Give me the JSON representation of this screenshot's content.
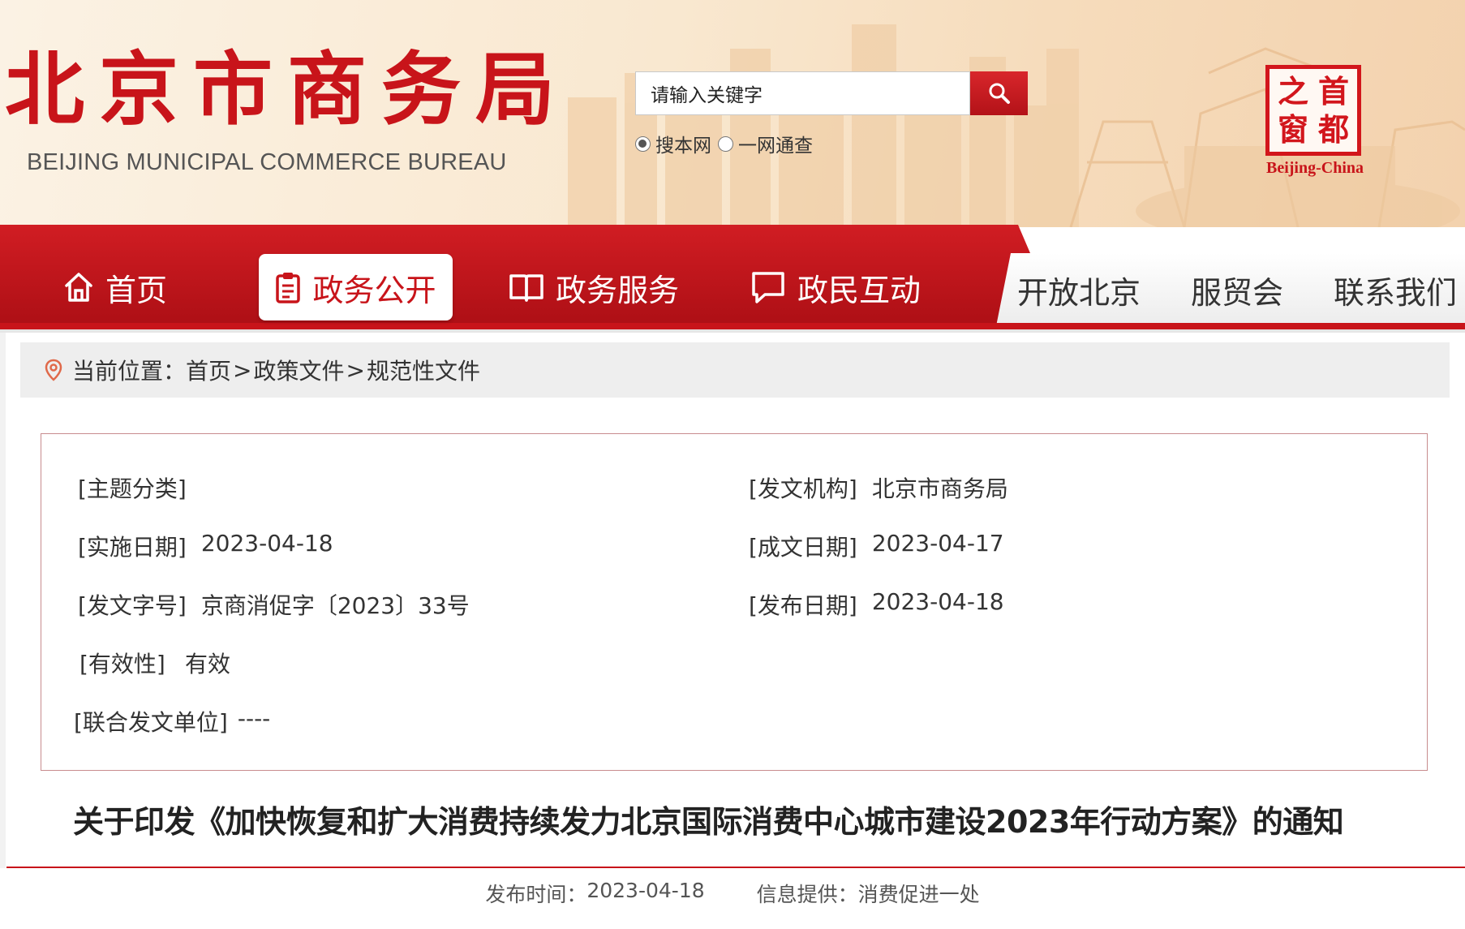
{
  "header": {
    "title": "北京市商务局",
    "subtitle": "BEIJING MUNICIPAL COMMERCE BUREAU",
    "search_placeholder": "请输入关键字",
    "search_options": [
      {
        "label": "搜本网",
        "selected": true
      },
      {
        "label": "一网通查",
        "selected": false
      }
    ],
    "seal_chars": [
      "之",
      "首",
      "窗",
      "都"
    ],
    "seal_caption": "Beijing-China"
  },
  "nav": {
    "items": [
      {
        "label": "首页",
        "icon": "home-icon",
        "active": false
      },
      {
        "label": "政务公开",
        "icon": "clipboard-icon",
        "active": true
      },
      {
        "label": "政务服务",
        "icon": "book-icon",
        "active": false
      },
      {
        "label": "政民互动",
        "icon": "chat-icon",
        "active": false
      },
      {
        "label": "开放北京",
        "active": false
      },
      {
        "label": "服贸会",
        "active": false
      },
      {
        "label": "联系我们",
        "active": false
      }
    ]
  },
  "breadcrumb": {
    "prefix": "当前位置：",
    "items": [
      "首页",
      "政策文件",
      "规范性文件"
    ],
    "separator": ">"
  },
  "doc_info": {
    "topic": {
      "label": "[主题分类]",
      "value": ""
    },
    "issuer": {
      "label": "[发文机构]",
      "value": "北京市商务局"
    },
    "effective_date": {
      "label": "[实施日期]",
      "value": "2023-04-18"
    },
    "written_date": {
      "label": "[成文日期]",
      "value": "2023-04-17"
    },
    "doc_number": {
      "label": "[发文字号]",
      "value": "京商消促字〔2023〕33号"
    },
    "publish_date": {
      "label": "[发布日期]",
      "value": "2023-04-18"
    },
    "validity": {
      "label": "[有效性]",
      "value": "有效"
    },
    "joint_issuers": {
      "label": "[联合发文单位]",
      "value": "----"
    }
  },
  "article": {
    "title": "关于印发《加快恢复和扩大消费持续发力北京国际消费中心城市建设2023年行动方案》的通知",
    "publish_time_label": "发布时间：",
    "publish_time": "2023-04-18",
    "provider_label": "信息提供：",
    "provider": "消费促进一处"
  },
  "colors": {
    "brand_red": "#c8141a",
    "header_bg": "#f9e8d0",
    "breadcrumb_bg": "#eeeeee"
  }
}
